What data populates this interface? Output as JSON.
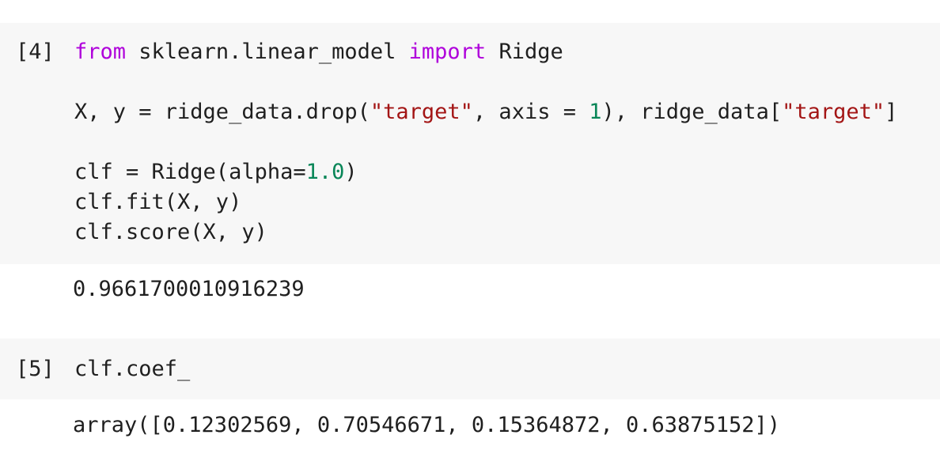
{
  "cells": [
    {
      "prompt": "[4]",
      "lines": [
        [
          {
            "t": "from",
            "c": "kw"
          },
          {
            "t": " sklearn.linear_model ",
            "c": "plain"
          },
          {
            "t": "import",
            "c": "kw"
          },
          {
            "t": " Ridge",
            "c": "plain"
          }
        ],
        [],
        [
          {
            "t": "X, y = ridge_data.drop(",
            "c": "plain"
          },
          {
            "t": "\"target\"",
            "c": "str"
          },
          {
            "t": ", axis = ",
            "c": "plain"
          },
          {
            "t": "1",
            "c": "num"
          },
          {
            "t": "), ridge_data[",
            "c": "plain"
          },
          {
            "t": "\"target\"",
            "c": "str"
          },
          {
            "t": "]",
            "c": "plain"
          }
        ],
        [],
        [
          {
            "t": "clf = Ridge(alpha=",
            "c": "plain"
          },
          {
            "t": "1.0",
            "c": "num"
          },
          {
            "t": ")",
            "c": "plain"
          }
        ],
        [
          {
            "t": "clf.fit(X, y)",
            "c": "plain"
          }
        ],
        [
          {
            "t": "clf.score(X, y)",
            "c": "plain"
          }
        ]
      ],
      "output": "0.9661700010916239"
    },
    {
      "prompt": "[5]",
      "lines": [
        [
          {
            "t": "clf.coef_",
            "c": "plain"
          }
        ]
      ],
      "output": "array([0.12302569, 0.70546671, 0.15364872, 0.63875152])"
    }
  ]
}
